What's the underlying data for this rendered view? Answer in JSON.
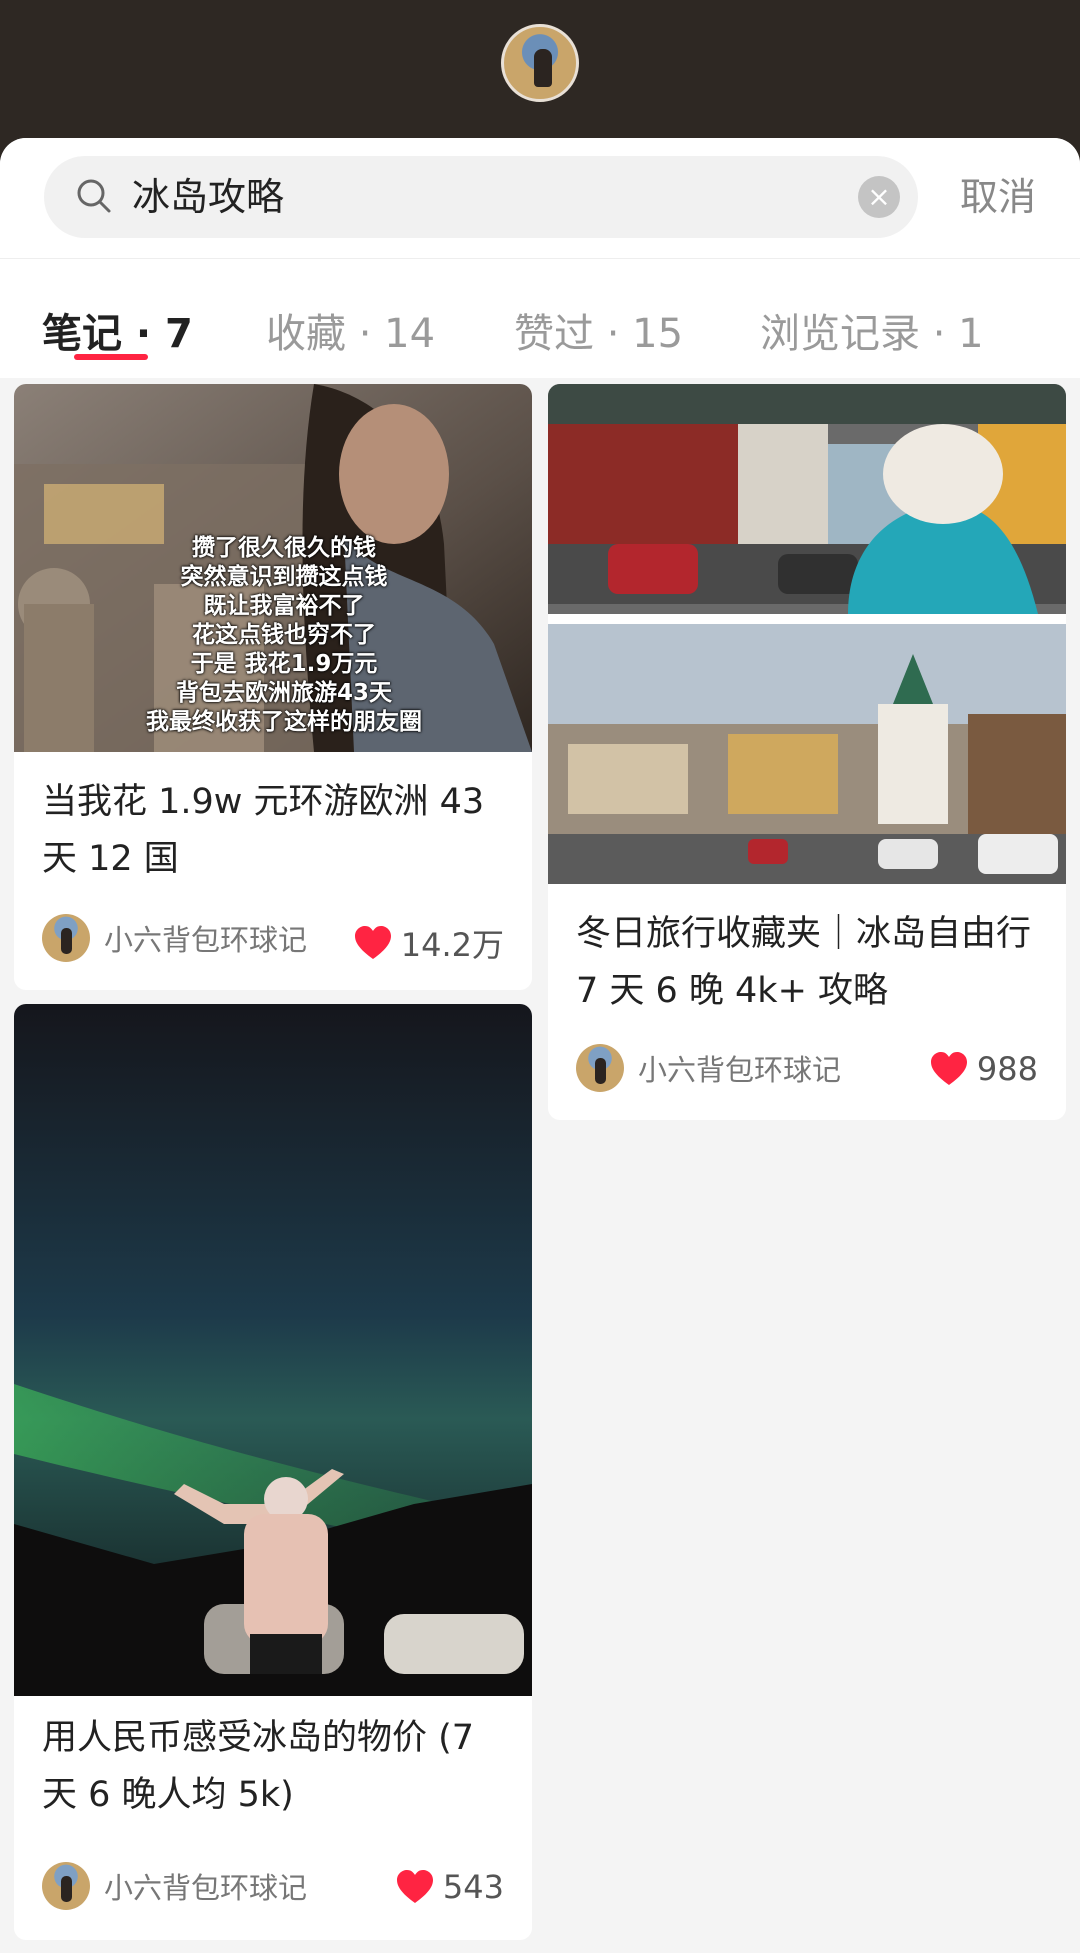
{
  "search": {
    "query": "冰岛攻略",
    "cancel_label": "取消"
  },
  "tabs": [
    {
      "label": "笔记 · 7"
    },
    {
      "label": "收藏 · 14"
    },
    {
      "label": "赞过 · 15"
    },
    {
      "label": "浏览记录 · 1"
    }
  ],
  "cards": [
    {
      "overlay": [
        "攒了很久很久的钱",
        "突然意识到攒这点钱",
        "既让我富裕不了",
        "花这点钱也穷不了",
        "于是 我花1.9万元",
        "背包去欧洲旅游43天",
        "我最终收获了这样的朋友圈"
      ],
      "title": "当我花 1.9w 元环游欧洲 43 天 12 国",
      "author": "小六背包环球记",
      "likes": "14.2万"
    },
    {
      "title": "冬日旅行收藏夹｜冰岛自由行 7 天 6 晚 4k+ 攻略",
      "author": "小六背包环球记",
      "likes": "988"
    },
    {
      "title": "用人民币感受冰岛的物价 (7 天 6 晚人均 5k)",
      "author": "小六背包环球记",
      "likes": "543"
    }
  ],
  "colors": {
    "accent": "#ff2442",
    "heart": "#ff2442"
  }
}
